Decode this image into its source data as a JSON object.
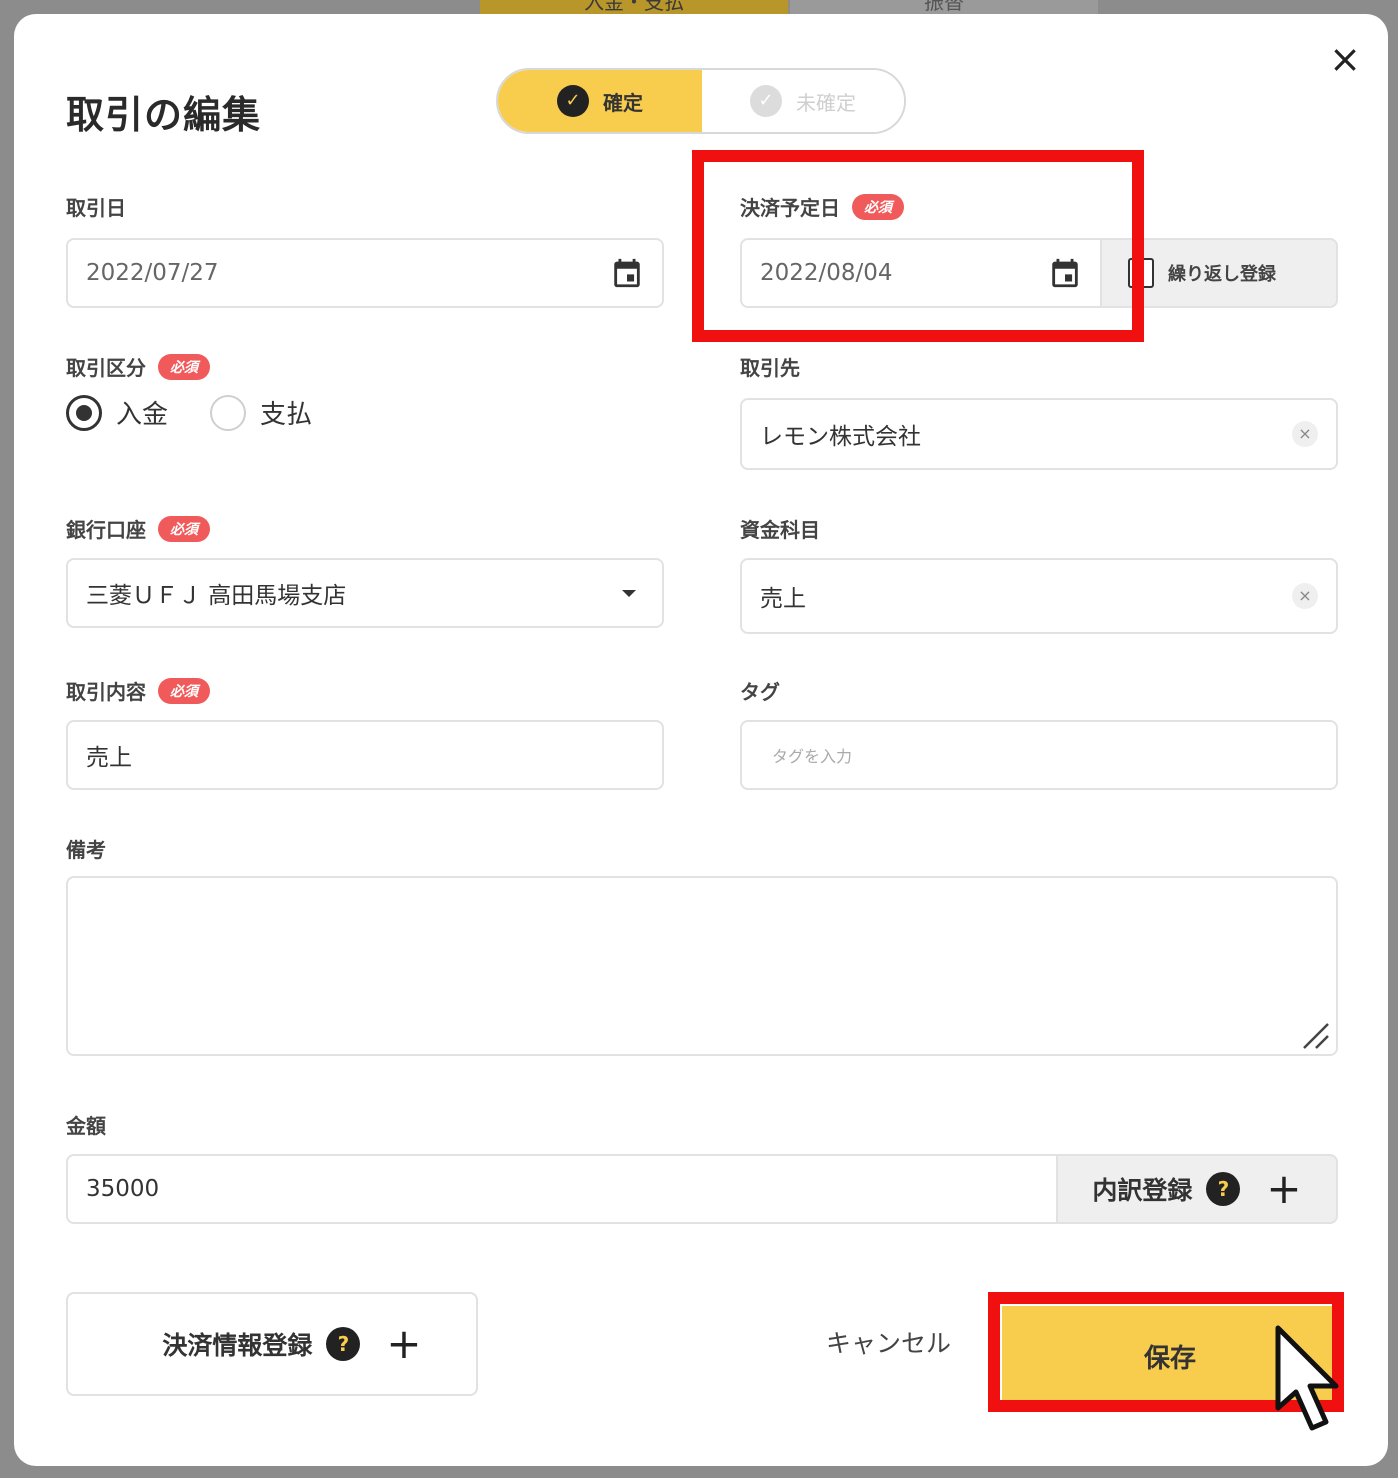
{
  "modal": {
    "title": "取引の編集",
    "close_glyph": "×"
  },
  "status_toggle": {
    "confirmed_label": "確定",
    "unconfirmed_label": "未確定",
    "selected": "確定"
  },
  "required_badge": "必須",
  "fields": {
    "transaction_date": {
      "label": "取引日",
      "value": "2022/07/27"
    },
    "due_date": {
      "label": "決済予定日",
      "value": "2022/08/04",
      "repeat_label": "繰り返し登録"
    },
    "transaction_type": {
      "label": "取引区分",
      "options": [
        "入金",
        "支払"
      ],
      "selected": "入金"
    },
    "partner": {
      "label": "取引先",
      "value": "レモン株式会社"
    },
    "bank_account": {
      "label": "銀行口座",
      "value": "三菱ＵＦＪ 高田馬場支店"
    },
    "fund_account": {
      "label": "資金科目",
      "value": "売上"
    },
    "content": {
      "label": "取引内容",
      "value": "売上"
    },
    "tag": {
      "label": "タグ",
      "placeholder": "タグを入力"
    },
    "memo": {
      "label": "備考",
      "value": ""
    },
    "amount": {
      "label": "金額",
      "value": "35000",
      "breakdown_label": "内訳登録"
    }
  },
  "footer": {
    "settlement_label": "決済情報登録",
    "cancel_label": "キャンセル",
    "save_label": "保存"
  },
  "backdrop": {
    "tab1": "入金・支払",
    "tab2": "振替"
  },
  "icons": {
    "help_glyph": "?",
    "plus_glyph": "+",
    "check_glyph": "✓",
    "clear_glyph": "×"
  },
  "colors": {
    "accent": "#f8cd4e",
    "required": "#f05a5a",
    "highlight": "#f01010"
  }
}
